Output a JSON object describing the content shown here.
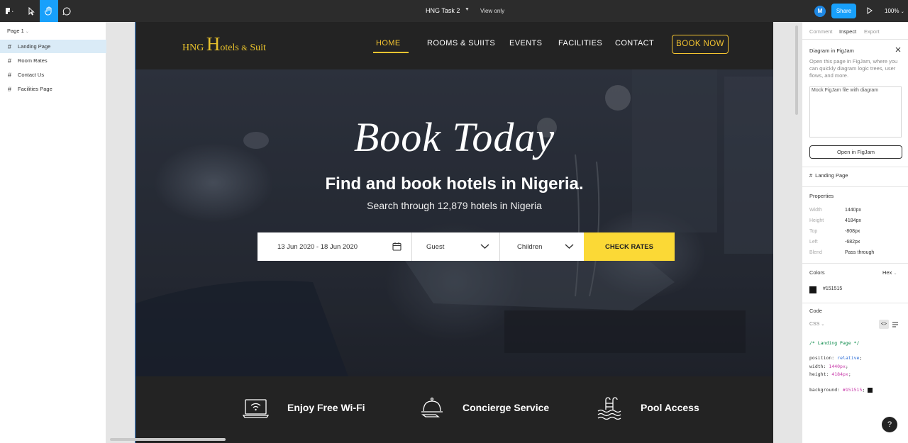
{
  "toolbar": {
    "file_title": "HNG Task 2",
    "view_mode": "View only",
    "avatar_initial": "M",
    "share_label": "Share",
    "zoom": "100%"
  },
  "layers": {
    "page_selector": "Page 1",
    "items": [
      {
        "label": "Landing Page",
        "selected": true
      },
      {
        "label": "Room Rates",
        "selected": false
      },
      {
        "label": "Contact Us",
        "selected": false
      },
      {
        "label": "Facilities Page",
        "selected": false
      }
    ]
  },
  "design": {
    "logo": {
      "pre": "HNG ",
      "big": "H",
      "mid": "otels ",
      "amp": "&",
      "post": " Suit"
    },
    "nav": [
      "HOME",
      "ROOMS & SUIITS",
      "EVENTS",
      "FACILITIES",
      "CONTACT"
    ],
    "book_now": "BOOK NOW",
    "hero_title": "Book Today",
    "hero_heading": "Find and book hotels in Nigeria.",
    "hero_sub": "Search through 12,879 hotels in Nigeria",
    "search": {
      "date": "13 Jun 2020 - 18 Jun 2020",
      "guest": "Guest",
      "children": "Children",
      "cta": "CHECK RATES"
    },
    "features": [
      "Enjoy Free Wi-Fi",
      "Concierge Service",
      "Pool Access"
    ]
  },
  "inspect": {
    "tabs": [
      "Comment",
      "Inspect",
      "Export"
    ],
    "figjam_title": "Diagram in FigJam",
    "figjam_text": [
      "Open this page in FigJam, where you",
      "can quickly diagram logic trees, user",
      "flows, and more."
    ],
    "figjam_img_alt": "Mock FigJam file with diagram",
    "figjam_button": "Open in FigJam",
    "frame_name": "Landing Page",
    "properties_title": "Properties",
    "properties": [
      {
        "label": "Width",
        "value": "1440px"
      },
      {
        "label": "Height",
        "value": "4184px"
      },
      {
        "label": "Top",
        "value": "-808px"
      },
      {
        "label": "Left",
        "value": "-682px"
      },
      {
        "label": "Blend",
        "value": "Pass through"
      }
    ],
    "colors_title": "Colors",
    "color_format": "Hex",
    "color_value": "#151515",
    "code_title": "Code",
    "code_lang": "CSS",
    "code": {
      "comment": "/* Landing Page */",
      "position_prop": "position:",
      "position_val": "relative",
      "width_prop": "width:",
      "width_val": "1440px",
      "height_prop": "height:",
      "height_val": "4184px",
      "bg_prop": "background:",
      "bg_val": "#151515"
    }
  },
  "help_label": "?",
  "colors": {
    "accent": "#18a0fb",
    "gold": "#f4c430",
    "frame_bg": "#151515"
  }
}
